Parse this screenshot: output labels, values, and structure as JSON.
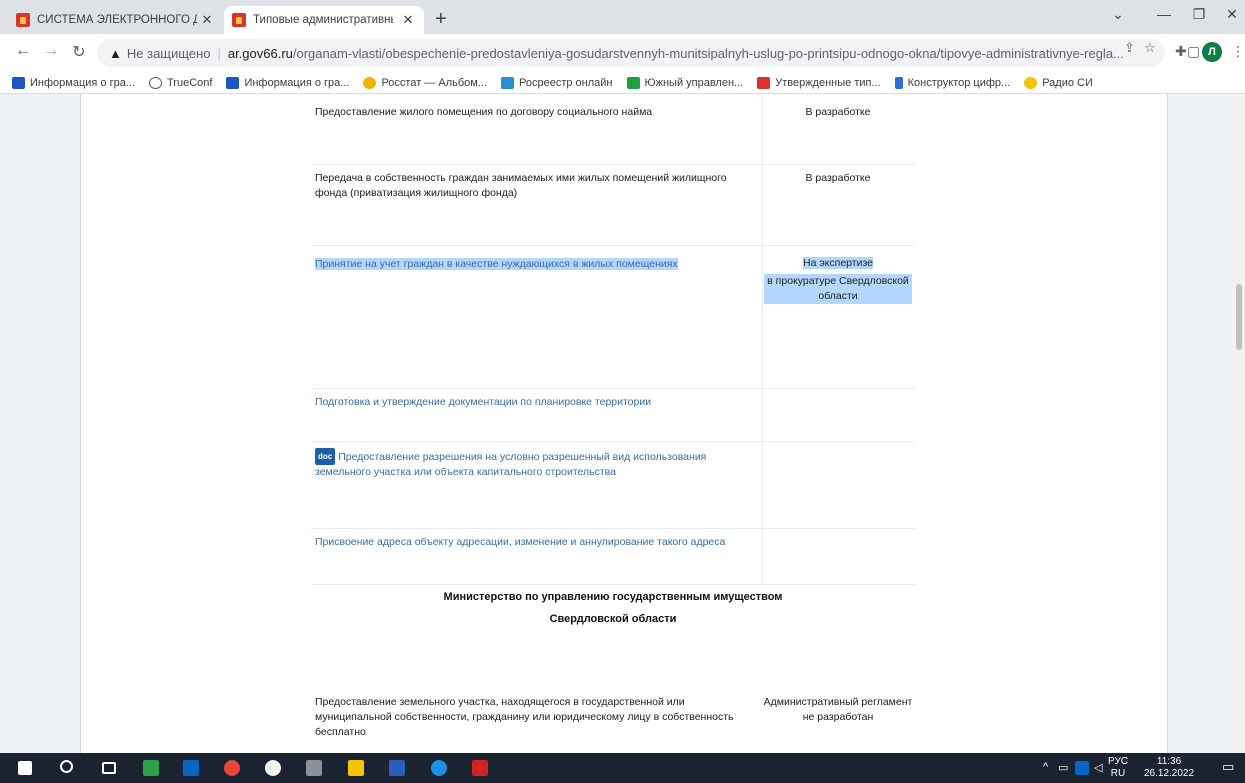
{
  "tabs": [
    {
      "title": "СИСТЕМА ЭЛЕКТРОННОГО ДОКУМЕНТООБОРОТА",
      "active": false
    },
    {
      "title": "Типовые административные регламенты",
      "active": true
    }
  ],
  "toolbar": {
    "security": "Не защищено",
    "url_host": "ar.gov66.ru",
    "url_path": "/organam-vlasti/obespechenie-predostavleniya-gosudarstvennyh-munitsipalnyh-uslug-po-printsipu-odnogo-okna/tipovye-administrativnye-regla...",
    "profile_initial": "Л"
  },
  "bookmarks": [
    {
      "label": "Информация о гра...",
      "color": "#1a56c4"
    },
    {
      "label": "TrueConf",
      "color": "#ffffff"
    },
    {
      "label": "Информация о гра...",
      "color": "#1a56c4"
    },
    {
      "label": "Росстат — Альбом...",
      "color": "#f0b400"
    },
    {
      "label": "Росреестр онлайн",
      "color": "#2b8fd6"
    },
    {
      "label": "Южный управлен...",
      "color": "#1f9d45"
    },
    {
      "label": "Утвержденные тип...",
      "color": "#d9342b"
    },
    {
      "label": "Конструктор цифр...",
      "color": "#2b6fd6"
    },
    {
      "label": "Радио СИ",
      "color": "#f5c400"
    }
  ],
  "rows": [
    {
      "service": "Предоставление жилого помещения по договору социального найма",
      "status": "В разработке"
    },
    {
      "service": "Передача в собственность граждан занимаемых ими жилых помещений жилищного фонда (приватизация жилищного фонда)",
      "status": "В разработке"
    },
    {
      "service": "Принятие на учет граждан в качестве нуждающихся в жилых помещениях",
      "status_line1": "На экспертизе",
      "status_line2": "в прокуратуре Свердловской области"
    },
    {
      "service": "Подготовка и утверждение документации по планировке территории",
      "status": ""
    },
    {
      "badge": "doc",
      "service": "Предоставление разрешения на условно разрешенный вид использования земельного участка или объекта капитального строительства",
      "status": ""
    },
    {
      "service": "Присвоение адреса объекту адресации, изменение и аннулирование такого адреса",
      "status": ""
    }
  ],
  "ministry": {
    "line1": "Министерство по управлению государственным имуществом",
    "line2": "Свердловской области"
  },
  "last_row": {
    "service": "Предоставление земельного участка, находящегося в государственной или муниципальной собственности, гражданину или юридическому лицу в собственность бесплатно",
    "status": "Административный регламент не разработан"
  },
  "taskbar": {
    "lang": "РУС",
    "locale": "RU",
    "time": "11:36",
    "date": "26.12.2022"
  }
}
